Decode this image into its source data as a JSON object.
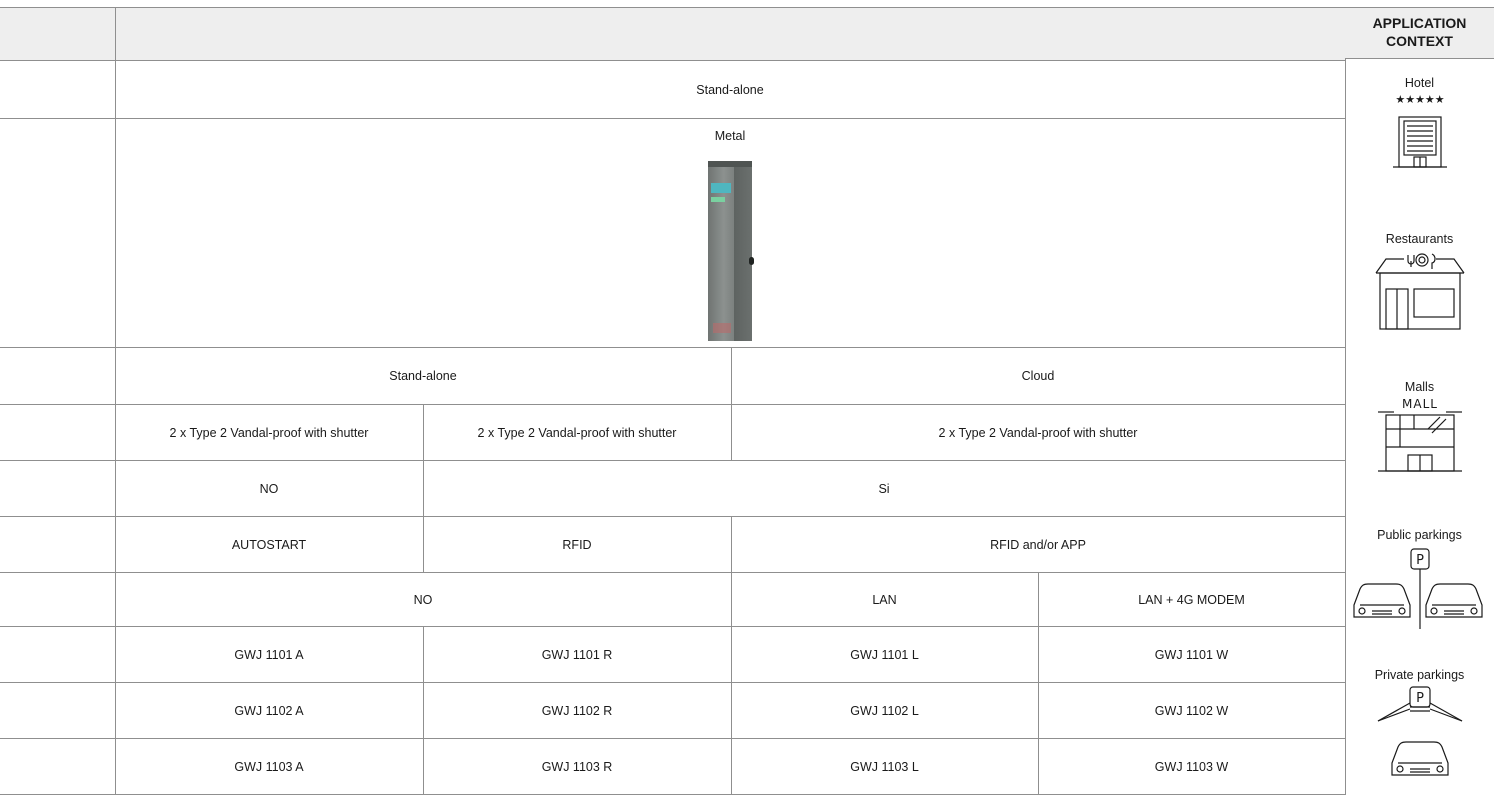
{
  "header": {
    "context_title": "APPLICATION\nCONTEXT"
  },
  "table": {
    "row_top": "Stand-alone",
    "material": "Metal",
    "control_groups": [
      "Stand-alone",
      "Cloud"
    ],
    "sockets": [
      "2 x Type 2 Vandal-proof with shutter",
      "2 x Type 2 Vandal-proof with shutter",
      "2 x Type 2 Vandal-proof with shutter"
    ],
    "option_row": [
      "NO",
      "Si"
    ],
    "auth_row": [
      "AUTOSTART",
      "RFID",
      "RFID and/or APP"
    ],
    "conn_row": [
      "NO",
      "LAN",
      "LAN + 4G MODEM"
    ],
    "codes": [
      [
        "GWJ 1101 A",
        "GWJ 1101 R",
        "GWJ 1101 L",
        "GWJ 1101 W"
      ],
      [
        "GWJ 1102 A",
        "GWJ 1102 R",
        "GWJ 1102 L",
        "GWJ 1102 W"
      ],
      [
        "GWJ 1103 A",
        "GWJ 1103 R",
        "GWJ 1103 L",
        "GWJ 1103 W"
      ]
    ]
  },
  "contexts": [
    {
      "label": "Hotel",
      "icon": "hotel-icon",
      "stars": "★★★★★"
    },
    {
      "label": "Restaurants",
      "icon": "restaurant-icon"
    },
    {
      "label": "Malls",
      "icon": "mall-icon",
      "sign": "MALL"
    },
    {
      "label": "Public parkings",
      "icon": "public-parking-icon",
      "sign": "P"
    },
    {
      "label": "Private parkings",
      "icon": "private-parking-icon",
      "sign": "P"
    }
  ]
}
